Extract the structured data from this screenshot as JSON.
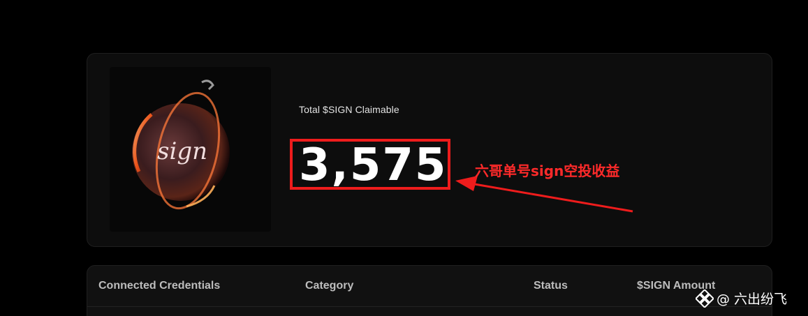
{
  "claim": {
    "label": "Total $SIGN Claimable",
    "amount": "3,575"
  },
  "annotation": {
    "text": "六哥单号sign空投收益",
    "color": "#ee1c1c"
  },
  "credentials_table": {
    "columns": [
      "Connected Credentials",
      "Category",
      "Status",
      "$SIGN Amount"
    ]
  },
  "watermark": {
    "text": "@ 六出纷飞",
    "icon": "binance-logo-icon"
  },
  "colors": {
    "background": "#000000",
    "card": "#0d0d0d",
    "text_primary": "#ffffff",
    "text_secondary": "#bdbdbd",
    "orb_glow": "#ff6a2a"
  }
}
